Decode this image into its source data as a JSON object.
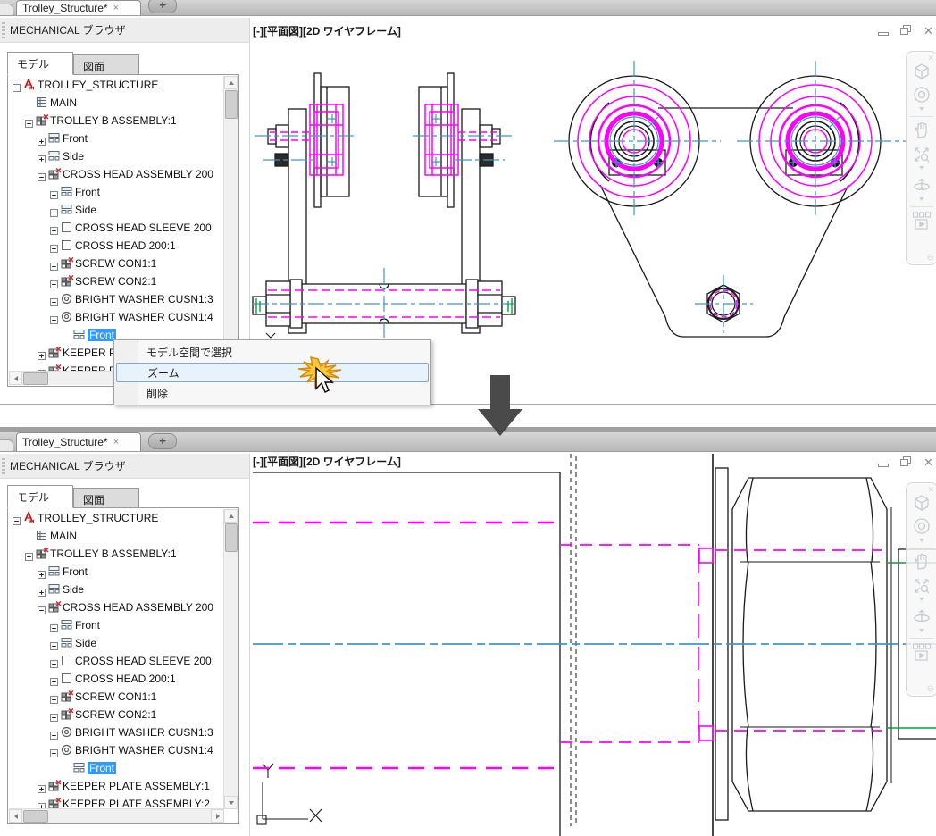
{
  "colors": {
    "magenta": "#FF00FF",
    "centerline_blue": "#3E95CB",
    "green": "#00A43C",
    "selection_blue": "#3399FF",
    "menu_hover_fill": "#E8F2FB",
    "menu_hover_border": "#84A7CC",
    "starburst_fill": "#FFC83D",
    "starburst_edge": "#D98A00",
    "arrow_gray": "#4A4A4A"
  },
  "tab_bar": {
    "active_tab": "Trolley_Structure*",
    "close_glyph": "×",
    "new_tab_glyph": "+"
  },
  "browser": {
    "title": "MECHANICAL ブラウザ",
    "tabs": {
      "model": "モデル",
      "drawing": "図面"
    }
  },
  "viewport": {
    "title": "[-][平面図][2D ワイヤフレーム]",
    "close_glyph": "✕"
  },
  "tree": {
    "items": [
      {
        "indent": 0,
        "expand": "minus",
        "icon": "am",
        "label": "TROLLEY_STRUCTURE"
      },
      {
        "indent": 1,
        "expand": "none",
        "icon": "table",
        "label": "MAIN"
      },
      {
        "indent": 1,
        "expand": "minus",
        "icon": "asm",
        "label": "TROLLEY B ASSEMBLY:1"
      },
      {
        "indent": 2,
        "expand": "plus",
        "icon": "view",
        "label": "Front"
      },
      {
        "indent": 2,
        "expand": "plus",
        "icon": "view",
        "label": "Side"
      },
      {
        "indent": 2,
        "expand": "minus",
        "icon": "asm",
        "label": "CROSS HEAD ASSEMBLY 200"
      },
      {
        "indent": 3,
        "expand": "plus",
        "icon": "view",
        "label": "Front"
      },
      {
        "indent": 3,
        "expand": "plus",
        "icon": "view",
        "label": "Side"
      },
      {
        "indent": 3,
        "expand": "plus",
        "icon": "part",
        "label": "CROSS HEAD SLEEVE 200:"
      },
      {
        "indent": 3,
        "expand": "plus",
        "icon": "part",
        "label": "CROSS HEAD 200:1"
      },
      {
        "indent": 3,
        "expand": "plus",
        "icon": "asm",
        "label": "SCREW CON1:1"
      },
      {
        "indent": 3,
        "expand": "plus",
        "icon": "asm",
        "label": "SCREW CON2:1"
      },
      {
        "indent": 3,
        "expand": "plus",
        "icon": "washer",
        "label": "BRIGHT WASHER CUSN1:3"
      },
      {
        "indent": 3,
        "expand": "minus",
        "icon": "washer",
        "label": "BRIGHT WASHER CUSN1:4"
      },
      {
        "indent": 4,
        "expand": "none",
        "icon": "view",
        "label": "Front",
        "selected": true
      },
      {
        "indent": 2,
        "expand": "plus",
        "icon": "asm",
        "label": "KEEPER PLATE ASSEMBLY:1"
      },
      {
        "indent": 2,
        "expand": "plus",
        "icon": "asm",
        "label": "KEEPER PLATE ASSEMBLY:2"
      }
    ]
  },
  "context_menu": {
    "items": [
      "モデル空間で選択",
      "ズーム",
      "削除"
    ],
    "hover_index": 1
  }
}
